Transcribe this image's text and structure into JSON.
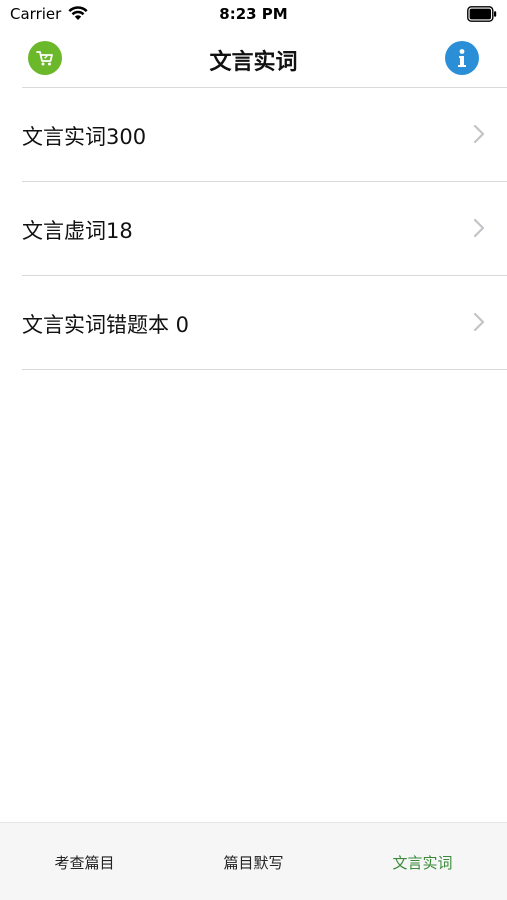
{
  "status_bar": {
    "carrier": "Carrier",
    "time": "8:23 PM"
  },
  "nav": {
    "title": "文言实词",
    "left_icon": "cart-icon",
    "right_icon": "info-icon",
    "left_color": "#6bb82a",
    "right_color": "#2b8fd8"
  },
  "list": {
    "items": [
      {
        "label": "文言实词300"
      },
      {
        "label": "文言虚词18"
      },
      {
        "label": "文言实词错题本 0"
      }
    ]
  },
  "tabs": {
    "items": [
      {
        "label": "考查篇目"
      },
      {
        "label": "篇目默写"
      },
      {
        "label": "文言实词"
      }
    ],
    "active_color": "#3a8a3a"
  }
}
